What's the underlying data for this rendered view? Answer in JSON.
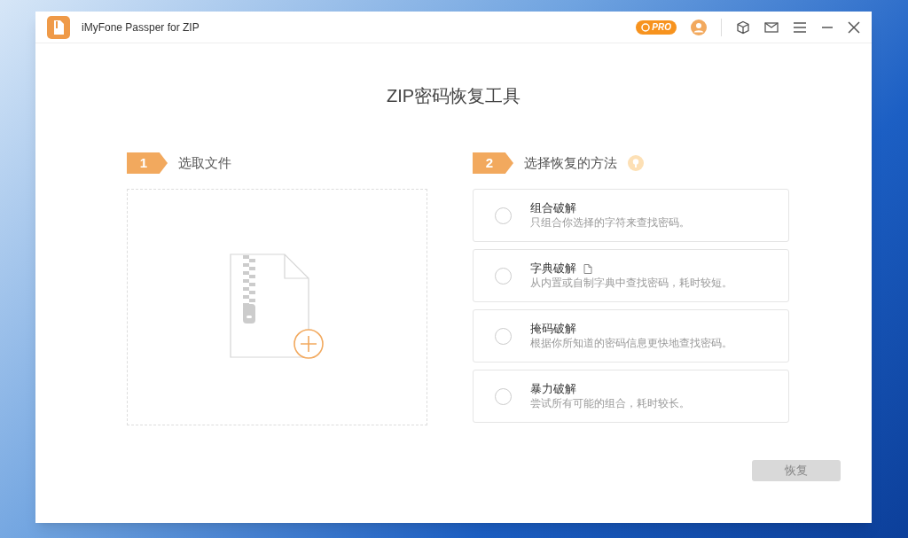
{
  "window": {
    "title": "iMyFone Passper for ZIP",
    "pro_badge": "PRO"
  },
  "heading": "ZIP密码恢复工具",
  "step1": {
    "number": "1",
    "label": "选取文件"
  },
  "step2": {
    "number": "2",
    "label": "选择恢复的方法"
  },
  "methods": [
    {
      "title": "组合破解",
      "description": "只组合你选择的字符来查找密码。",
      "selected": false,
      "has_file_icon": false
    },
    {
      "title": "字典破解",
      "description": "从内置或自制字典中查找密码，耗时较短。",
      "selected": false,
      "has_file_icon": true
    },
    {
      "title": "掩码破解",
      "description": "根据你所知道的密码信息更快地查找密码。",
      "selected": false,
      "has_file_icon": false
    },
    {
      "title": "暴力破解",
      "description": "尝试所有可能的组合，耗时较长。",
      "selected": false,
      "has_file_icon": false
    }
  ],
  "recover_button": {
    "label": "恢复",
    "disabled": true
  }
}
